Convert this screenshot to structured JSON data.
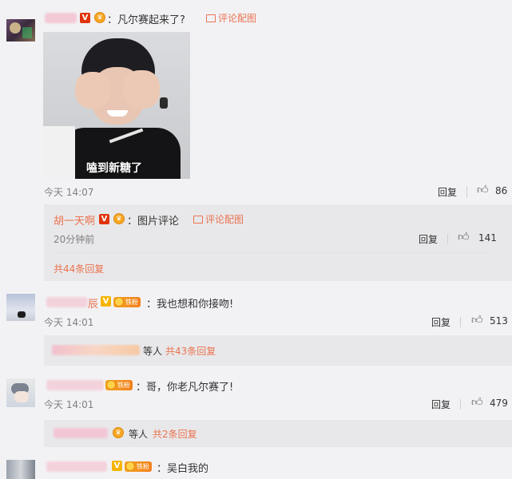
{
  "comment1": {
    "colon_text": "：凡尔赛起来了?",
    "pic_link": "评论配图",
    "image_caption": "嗑到新糖了",
    "time": "今天 14:07",
    "reply_label": "回复",
    "likes": "86",
    "sub": {
      "user": "胡一天啊",
      "colon_text": "：图片评论",
      "pic_link": "评论配图",
      "time": "20分钟前",
      "reply_label": "回复",
      "likes": "141",
      "total_replies": "共44条回复"
    }
  },
  "comment2": {
    "name_tail": "辰",
    "fan_badge": "铁粉",
    "colon_text": "：我也想和你接吻!",
    "time": "今天 14:01",
    "reply_label": "回复",
    "likes": "513",
    "others_text": "等人",
    "total_replies": "共43条回复"
  },
  "comment3": {
    "fan_badge": "铁粉",
    "colon_text": "：哥，你老凡尔赛了!",
    "time": "今天 14:01",
    "reply_label": "回复",
    "likes": "479",
    "others_text": "等人",
    "total_replies": "共2条回复"
  },
  "comment4": {
    "fan_badge": "铁粉",
    "colon_text": "：吴白我的"
  },
  "icons": {
    "thumb": "thumbs-up-icon",
    "picture": "picture-icon",
    "crown": "fan-crown-icon"
  },
  "colors": {
    "link_orange": "#eb7350",
    "v_red": "#e0330a",
    "v_yellow": "#f7b500",
    "background": "#f2f2f5"
  }
}
